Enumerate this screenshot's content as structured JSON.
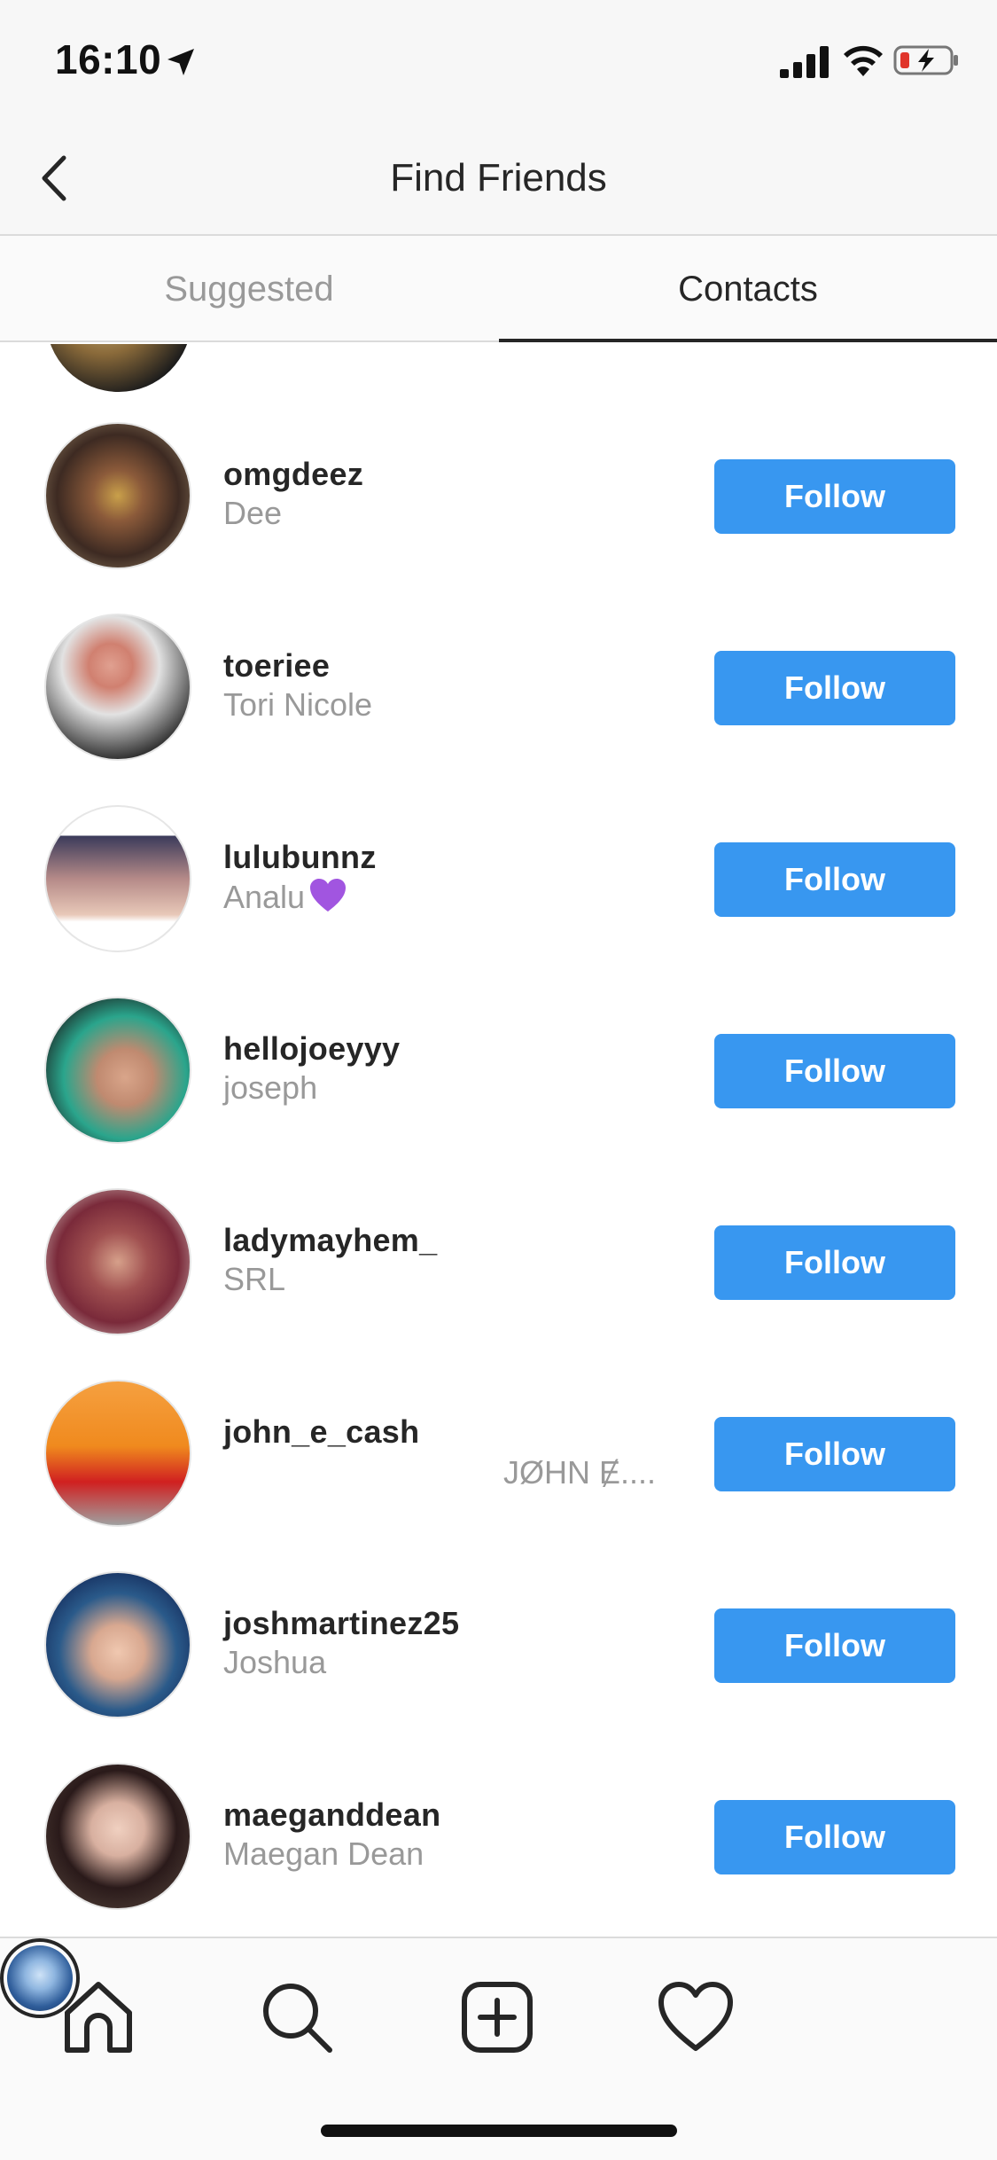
{
  "status_bar": {
    "time": "16:10",
    "icons": [
      "location-arrow-icon",
      "signal-icon",
      "wifi-icon",
      "battery-charging-icon"
    ]
  },
  "header": {
    "title": "Find Friends",
    "back_icon": "chevron-left-icon"
  },
  "tabs": [
    {
      "label": "Suggested",
      "active": false
    },
    {
      "label": "Contacts",
      "active": true
    }
  ],
  "contacts": [
    {
      "username": "omgdeez",
      "name": "Dee",
      "button": "Follow",
      "avatar_color": "#6b4a3a"
    },
    {
      "username": "toeriee",
      "name": "Tori Nicole",
      "button": "Follow",
      "avatar_color": "#cfcfcf"
    },
    {
      "username": "lulubunnz",
      "name": "Analu",
      "name_emoji": "purple-heart-emoji",
      "button": "Follow",
      "avatar_color": "#b58a88"
    },
    {
      "username": "hellojoeyyy",
      "name": "joseph",
      "button": "Follow",
      "avatar_color": "#2aa58c"
    },
    {
      "username": "ladymayhem_",
      "name": "SRL",
      "button": "Follow",
      "avatar_color": "#7a2a3a"
    },
    {
      "username": "john_e_cash",
      "name": "JØHN Ɇ....",
      "button": "Follow",
      "avatar_color": "#f08a1e"
    },
    {
      "username": "joshmartinez25",
      "name": "Joshua",
      "button": "Follow",
      "avatar_color": "#1e3a6e"
    },
    {
      "username": "maeganddean",
      "name": "Maegan Dean",
      "button": "Follow",
      "avatar_color": "#3a2a2a"
    }
  ],
  "bottom_nav": {
    "items": [
      "home-icon",
      "search-icon",
      "add-post-icon",
      "activity-heart-icon",
      "profile-avatar"
    ]
  },
  "colors": {
    "follow_button": "#3897f0",
    "secondary_text": "#999999",
    "primary_text": "#262626"
  }
}
